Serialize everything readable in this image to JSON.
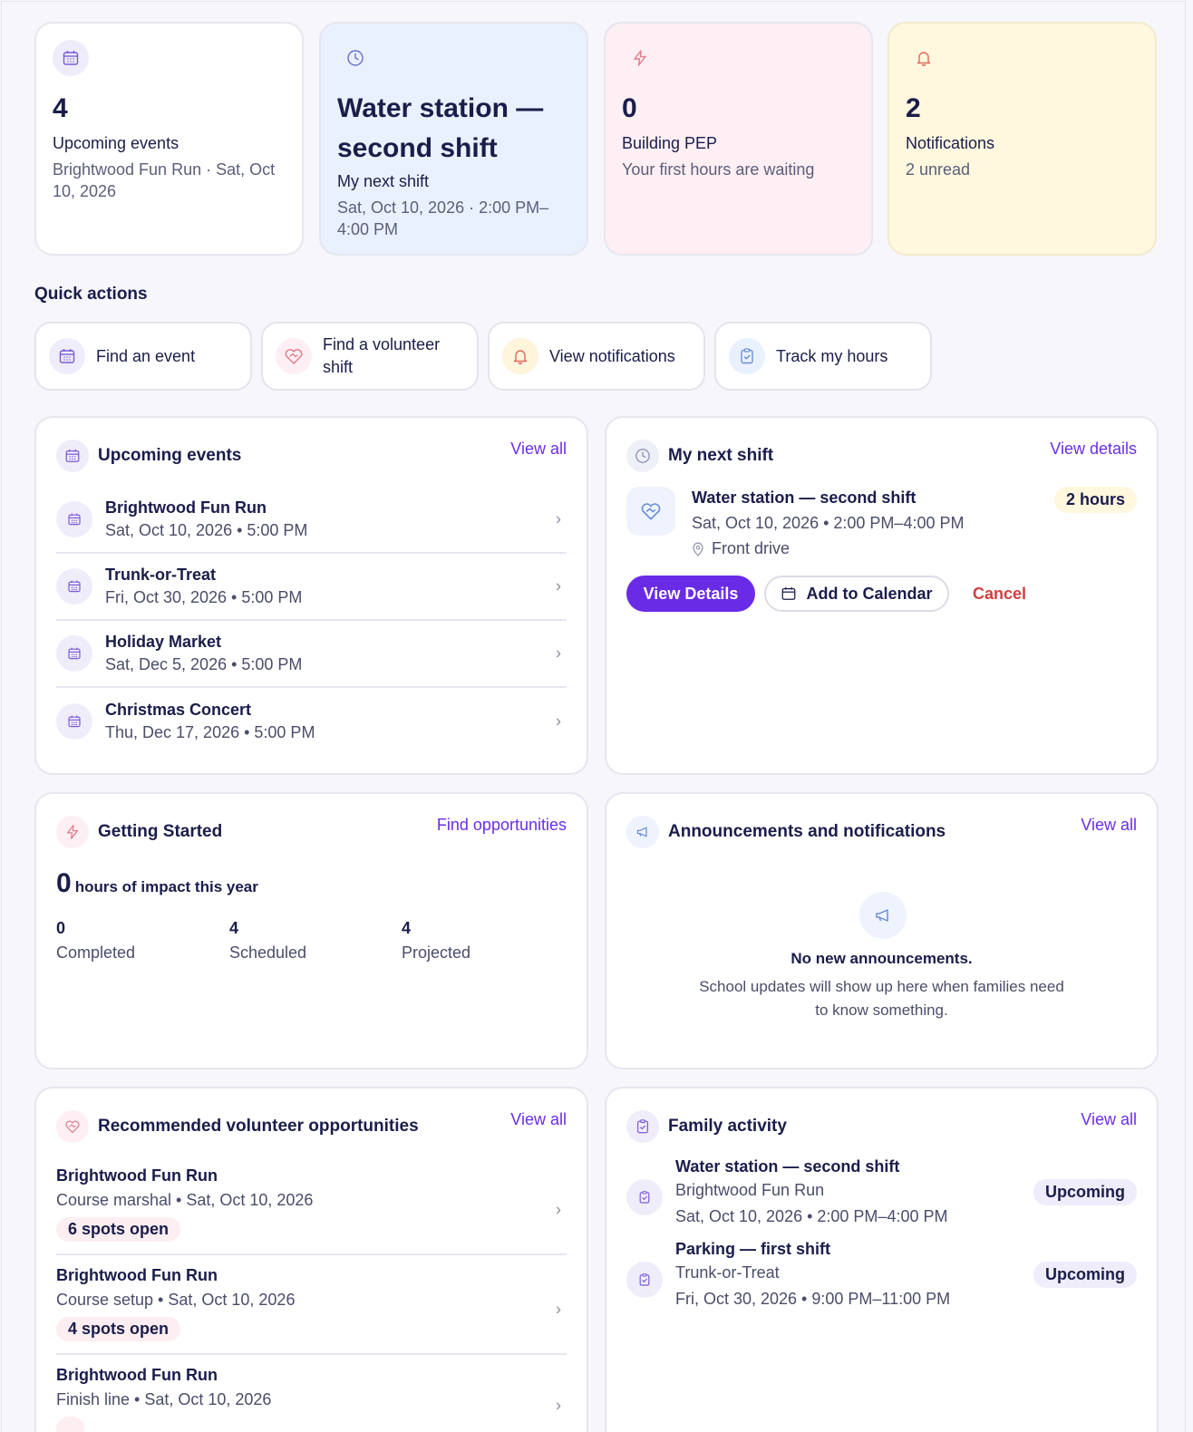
{
  "stats": [
    {
      "value": "4",
      "label": "Upcoming events",
      "sub": "Brightwood Fun Run · Sat, Oct 10, 2026",
      "icon": "calendar-icon",
      "bg": "#ffffff",
      "iconbg": "#efecfb",
      "iconcolor": "#7b5cd6"
    },
    {
      "value": "Water station — second shift",
      "label": "My next shift",
      "sub": "Sat, Oct 10, 2026 · 2:00 PM–4:00 PM",
      "icon": "clock-icon",
      "bg": "#eaf1fe",
      "iconbg": "#eaf1fe",
      "iconcolor": "#6a6fd0"
    },
    {
      "value": "0",
      "label": "Building PEP",
      "sub": "Your first hours are waiting",
      "icon": "lightning-icon",
      "bg": "#fdeff3",
      "iconbg": "#fdeff3",
      "iconcolor": "#e07a8a"
    },
    {
      "value": "2",
      "label": "Notifications",
      "sub": "2 unread",
      "icon": "bell-icon",
      "bg": "#fff7de",
      "iconbg": "#fff7de",
      "iconcolor": "#e06a5a"
    }
  ],
  "quick_actions": {
    "title": "Quick actions",
    "items": [
      {
        "label": "Find an event",
        "icon": "calendar-icon"
      },
      {
        "label": "Find a volunteer shift",
        "icon": "heart-handshake-icon"
      },
      {
        "label": "View notifications",
        "icon": "bell-icon"
      },
      {
        "label": "Track my hours",
        "icon": "clipboard-icon"
      }
    ]
  },
  "upcoming": {
    "title": "Upcoming events",
    "link": "View all",
    "events": [
      {
        "name": "Brightwood Fun Run",
        "date": "Sat, Oct 10, 2026 • 5:00 PM"
      },
      {
        "name": "Trunk-or-Treat",
        "date": "Fri, Oct 30, 2026 • 5:00 PM"
      },
      {
        "name": "Holiday Market",
        "date": "Sat, Dec 5, 2026 • 5:00 PM"
      },
      {
        "name": "Christmas Concert",
        "date": "Thu, Dec 17, 2026 • 5:00 PM"
      }
    ]
  },
  "next_shift": {
    "title": "My next shift",
    "link": "View details",
    "shift_name": "Water station — second shift",
    "shift_time": "Sat, Oct 10, 2026 • 2:00 PM–4:00 PM",
    "location": "Front drive",
    "hours": "2 hours",
    "view_details": "View Details",
    "add_calendar": "Add to Calendar",
    "cancel": "Cancel"
  },
  "getting_started": {
    "title": "Getting Started",
    "link": "Find opportunities",
    "hours_value": "0",
    "hours_label": "hours of impact this year",
    "stats": [
      {
        "n": "0",
        "l": "Completed"
      },
      {
        "n": "4",
        "l": "Scheduled"
      },
      {
        "n": "4",
        "l": "Projected"
      }
    ]
  },
  "announcements": {
    "title": "Announcements and notifications",
    "link": "View all",
    "empty_title": "No new announcements.",
    "empty_text": "School updates will show up here when families need to know something."
  },
  "recommended": {
    "title": "Recommended volunteer opportunities",
    "link": "View all",
    "items": [
      {
        "name": "Brightwood Fun Run",
        "sub": "Course marshal • Sat, Oct 10, 2026",
        "spots": "6 spots open"
      },
      {
        "name": "Brightwood Fun Run",
        "sub": "Course setup • Sat, Oct 10, 2026",
        "spots": "4 spots open"
      },
      {
        "name": "Brightwood Fun Run",
        "sub": "Finish line • Sat, Oct 10, 2026",
        "spots": ""
      }
    ]
  },
  "family": {
    "title": "Family activity",
    "link": "View all",
    "items": [
      {
        "name": "Water station — second shift",
        "event": "Brightwood Fun Run",
        "time": "Sat, Oct 10, 2026 • 2:00 PM–4:00 PM",
        "status": "Upcoming"
      },
      {
        "name": "Parking — first shift",
        "event": "Trunk-or-Treat",
        "time": "Fri, Oct 30, 2026 • 9:00 PM–11:00 PM",
        "status": "Upcoming"
      }
    ]
  },
  "colors": {
    "accent": "#6a2be6",
    "text": "#1a1d4a",
    "muted": "#4a4d6a",
    "danger": "#d23f3f"
  }
}
